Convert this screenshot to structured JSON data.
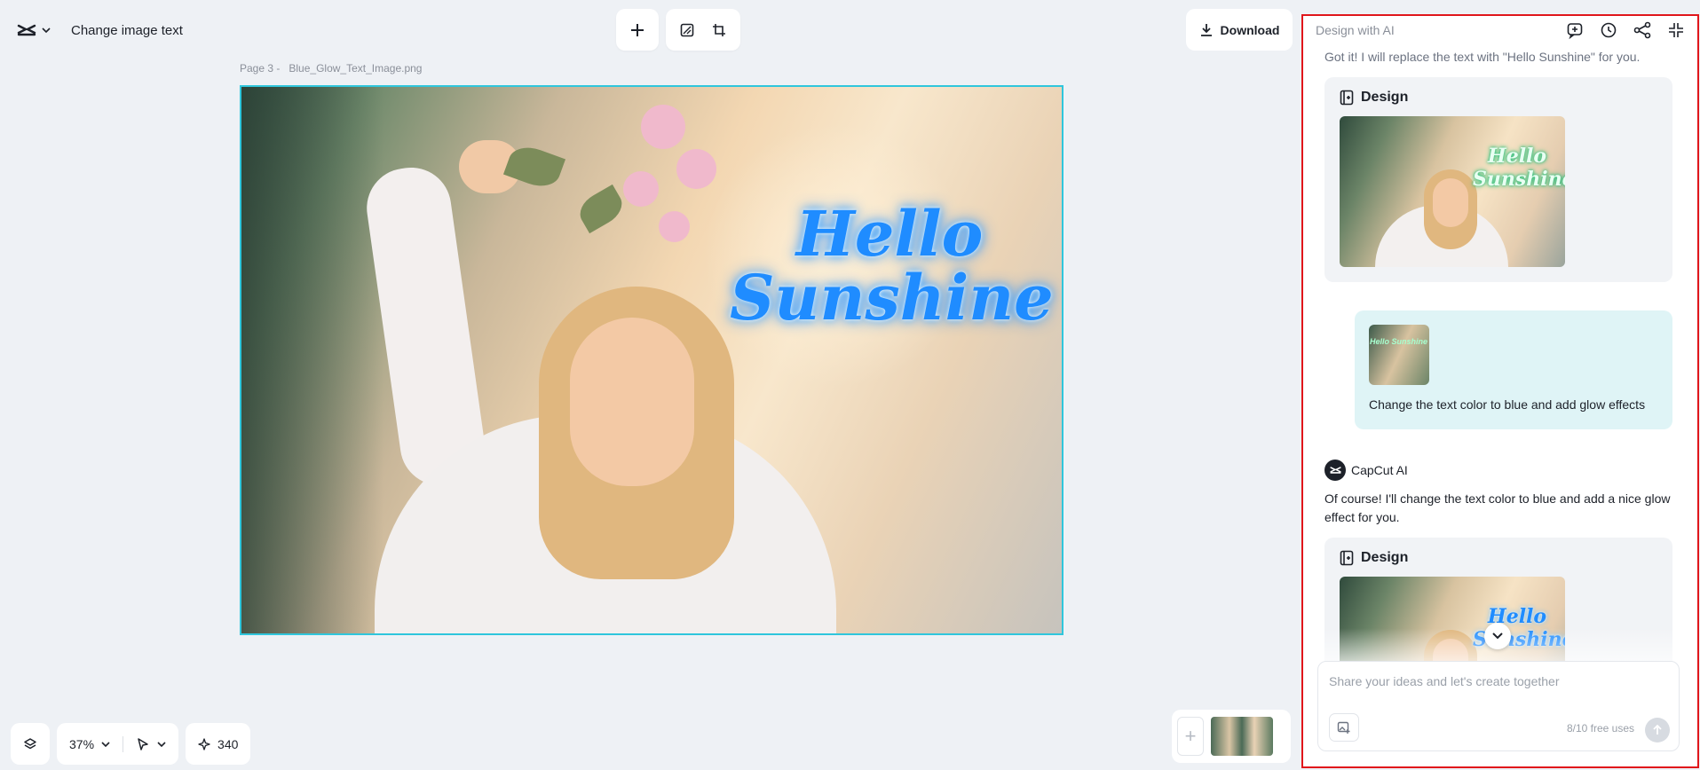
{
  "header": {
    "project_title": "Change image text",
    "download_label": "Download"
  },
  "canvas": {
    "page_label": "Page 3 -",
    "file_name": "Blue_Glow_Text_Image.png",
    "overlay_line1": "Hello",
    "overlay_line2": "Sunshine"
  },
  "bottom_bar": {
    "zoom": "37%",
    "credits": "340"
  },
  "ai_panel": {
    "title": "Design with AI",
    "previous_message": "Got it! I will replace the text with \"Hello Sunshine\" for you.",
    "design_label": "Design",
    "design_thumb_text_1": "Hello",
    "design_thumb_text_2": "Sunshine",
    "user_message": "Change the text color to blue and add glow effects",
    "user_thumb_text": "Hello Sunshine",
    "assistant_name": "CapCut AI",
    "assistant_message": "Of course! I'll change the text color to blue and add a nice glow effect for you.",
    "design_label_2": "Design",
    "input_placeholder": "Share your ideas and let's create together",
    "free_uses": "8/10 free uses"
  },
  "colors": {
    "accent_cyan": "#2fc6dc",
    "panel_border_red": "#e0161b",
    "glow_blue": "#1f8cff",
    "user_bubble": "#dff4f6"
  },
  "icons": [
    "capcut-logo-icon",
    "chevron-down-icon",
    "plus-icon",
    "resize-icon",
    "crop-icon",
    "download-icon",
    "layers-icon",
    "pointer-icon",
    "sparkle-icon",
    "new-chat-icon",
    "history-icon",
    "share-icon",
    "collapse-icon",
    "design-icon",
    "image-attach-icon",
    "send-icon"
  ]
}
